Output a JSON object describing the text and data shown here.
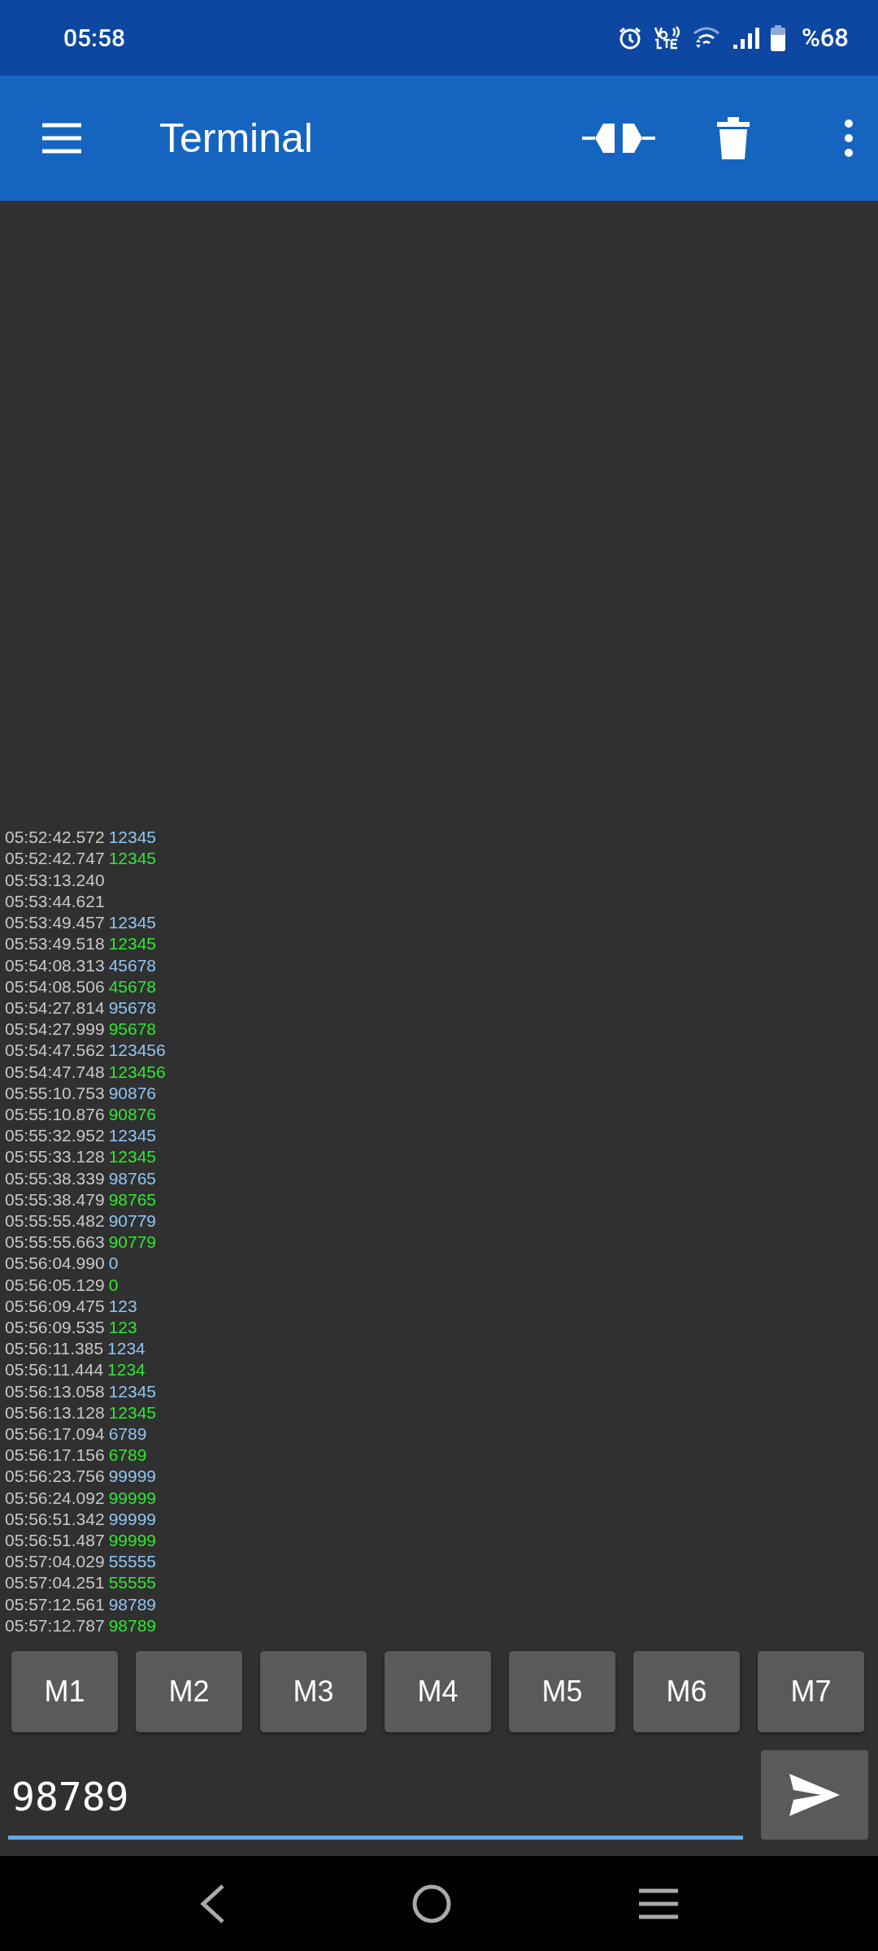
{
  "status_bar": {
    "time": "05:58",
    "battery": "%68"
  },
  "app_bar": {
    "title": "Terminal"
  },
  "log": [
    {
      "time": "05:52:42.572",
      "value": "12345",
      "kind": "sent"
    },
    {
      "time": "05:52:42.747",
      "value": "12345",
      "kind": "received"
    },
    {
      "time": "05:53:13.240"
    },
    {
      "time": "05:53:44.621"
    },
    {
      "time": "05:53:49.457",
      "value": "12345",
      "kind": "sent"
    },
    {
      "time": "05:53:49.518",
      "value": "12345",
      "kind": "received"
    },
    {
      "time": "05:54:08.313",
      "value": "45678",
      "kind": "sent"
    },
    {
      "time": "05:54:08.506",
      "value": "45678",
      "kind": "received"
    },
    {
      "time": "05:54:27.814",
      "value": "95678",
      "kind": "sent"
    },
    {
      "time": "05:54:27.999",
      "value": "95678",
      "kind": "received"
    },
    {
      "time": "05:54:47.562",
      "value": "123456",
      "kind": "sent"
    },
    {
      "time": "05:54:47.748",
      "value": "123456",
      "kind": "received"
    },
    {
      "time": "05:55:10.753",
      "value": "90876",
      "kind": "sent"
    },
    {
      "time": "05:55:10.876",
      "value": "90876",
      "kind": "received"
    },
    {
      "time": "05:55:32.952",
      "value": "12345",
      "kind": "sent"
    },
    {
      "time": "05:55:33.128",
      "value": "12345",
      "kind": "received"
    },
    {
      "time": "05:55:38.339",
      "value": "98765",
      "kind": "sent"
    },
    {
      "time": "05:55:38.479",
      "value": "98765",
      "kind": "received"
    },
    {
      "time": "05:55:55.482",
      "value": "90779",
      "kind": "sent"
    },
    {
      "time": "05:55:55.663",
      "value": "90779",
      "kind": "received"
    },
    {
      "time": "05:56:04.990",
      "value": "0",
      "kind": "sent"
    },
    {
      "time": "05:56:05.129",
      "value": "0",
      "kind": "received"
    },
    {
      "time": "05:56:09.475",
      "value": "123",
      "kind": "sent"
    },
    {
      "time": "05:56:09.535",
      "value": "123",
      "kind": "received"
    },
    {
      "time": "05:56:11.385",
      "value": "1234",
      "kind": "sent"
    },
    {
      "time": "05:56:11.444",
      "value": "1234",
      "kind": "received"
    },
    {
      "time": "05:56:13.058",
      "value": "12345",
      "kind": "sent"
    },
    {
      "time": "05:56:13.128",
      "value": "12345",
      "kind": "received"
    },
    {
      "time": "05:56:17.094",
      "value": "6789",
      "kind": "sent"
    },
    {
      "time": "05:56:17.156",
      "value": "6789",
      "kind": "received"
    },
    {
      "time": "05:56:23.756",
      "value": "99999",
      "kind": "sent"
    },
    {
      "time": "05:56:24.092",
      "value": "99999",
      "kind": "received"
    },
    {
      "time": "05:56:51.342",
      "value": "99999",
      "kind": "sent"
    },
    {
      "time": "05:56:51.487",
      "value": "99999",
      "kind": "received"
    },
    {
      "time": "05:57:04.029",
      "value": "55555",
      "kind": "sent"
    },
    {
      "time": "05:57:04.251",
      "value": "55555",
      "kind": "received"
    },
    {
      "time": "05:57:12.561",
      "value": "98789",
      "kind": "sent"
    },
    {
      "time": "05:57:12.787",
      "value": "98789",
      "kind": "received"
    }
  ],
  "macros": [
    "M1",
    "M2",
    "M3",
    "M4",
    "M5",
    "M6",
    "M7"
  ],
  "input": {
    "value": "98789"
  }
}
